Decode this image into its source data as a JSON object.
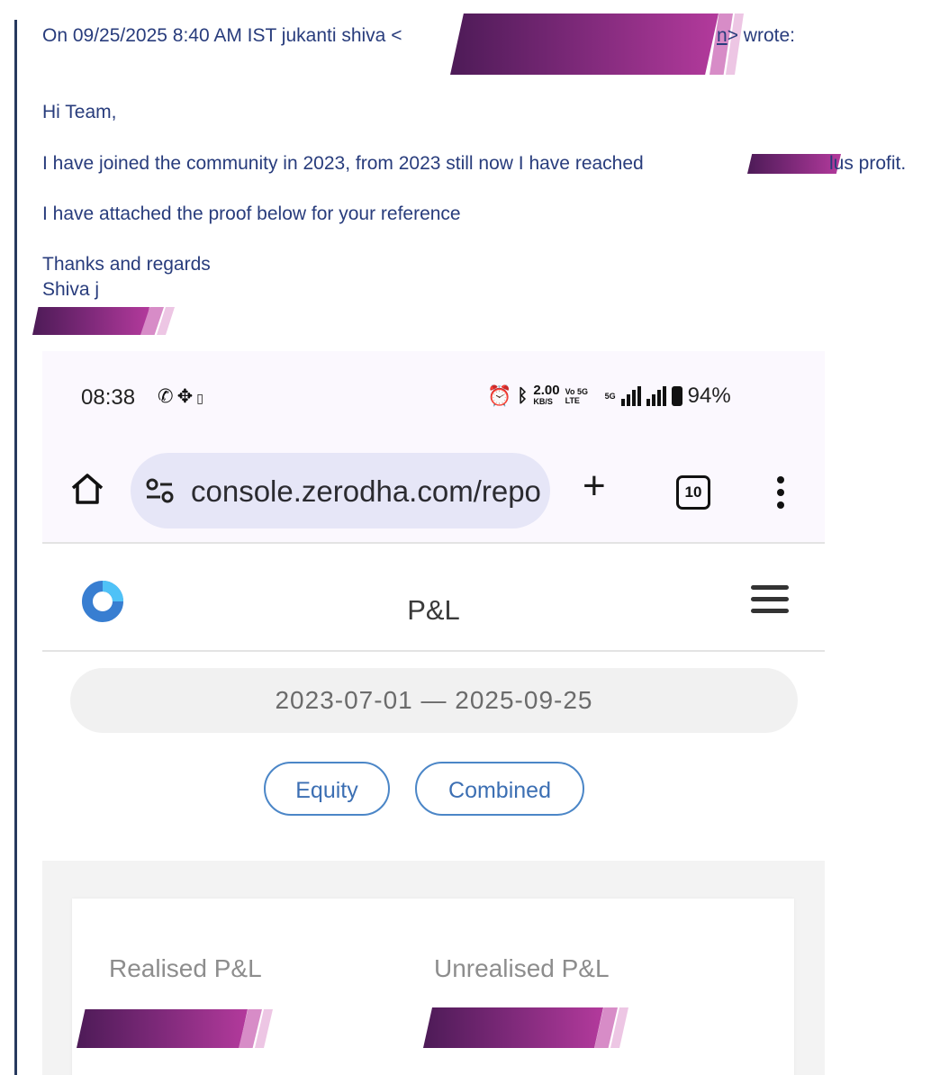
{
  "email": {
    "header_prefix": "On 09/25/2025 8:40 AM IST jukanti shiva <",
    "header_link_tail": "n",
    "header_suffix": "> wrote:",
    "greeting": "Hi Team,",
    "body_line1": "I have joined the community in 2023, from 2023 still now I have reached ",
    "body_line1_tail": "lus profit.",
    "body_line2": "I have attached the proof below for your reference",
    "closing": "Thanks and regards",
    "signature_name": "Shiva j"
  },
  "phone": {
    "status_bar": {
      "time": "08:38",
      "data_speed": "2.00",
      "data_speed_unit": "KB/S",
      "network_tag_1": "Vo 5G LTE",
      "network_tag_2": "5G",
      "battery": "94%",
      "left_icons": [
        "whatsapp-icon",
        "app-grid-icon",
        "sim-icon"
      ],
      "right_icons": [
        "alarm-icon",
        "bluetooth-icon",
        "signal-icon",
        "battery-icon"
      ]
    },
    "browser": {
      "url": "console.zerodha.com/repo",
      "tab_count": "10"
    },
    "app": {
      "title": "P&L",
      "date_range": "2023-07-01 — 2025-09-25",
      "segments": [
        "Equity",
        "Combined"
      ],
      "metrics": [
        {
          "label": "Realised P&L"
        },
        {
          "label": "Unrealised P&L"
        }
      ]
    },
    "colors": {
      "brand_blue": "#387ed1",
      "segment_border": "#4b86c7",
      "email_text": "#283c7c",
      "quote_bar": "#27395e"
    }
  }
}
